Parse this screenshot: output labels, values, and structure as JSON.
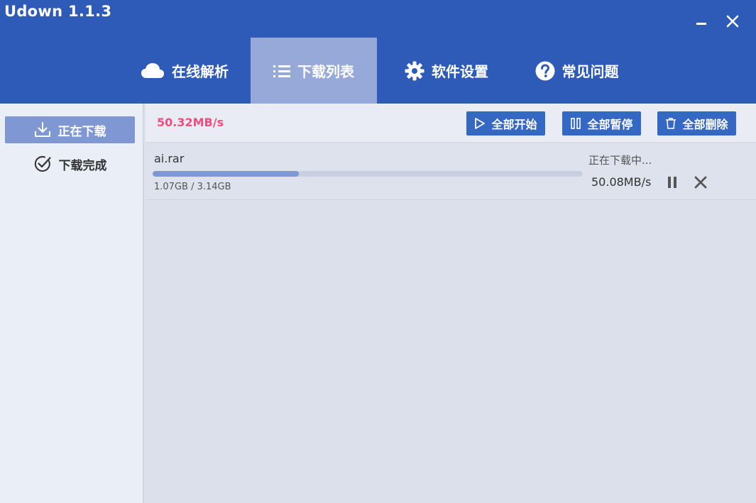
{
  "app": {
    "title": "Udown 1.1.3"
  },
  "window": {
    "minimize_icon": "minimize-icon",
    "close_icon": "close-icon"
  },
  "tabs": [
    {
      "label": "在线解析",
      "icon": "cloud-icon"
    },
    {
      "label": "下载列表",
      "icon": "list-icon",
      "active": true
    },
    {
      "label": "软件设置",
      "icon": "gear-icon"
    },
    {
      "label": "常见问题",
      "icon": "question-icon"
    }
  ],
  "sidebar": {
    "items": [
      {
        "label": "正在下载",
        "icon": "download-icon",
        "active": true
      },
      {
        "label": "下载完成",
        "icon": "check-circle-icon"
      }
    ]
  },
  "toolbar": {
    "total_speed": "50.32MB/s",
    "start_all_label": "全部开始",
    "pause_all_label": "全部暂停",
    "delete_all_label": "全部删除"
  },
  "tasks": [
    {
      "name": "ai.rar",
      "size_text": "1.07GB / 3.14GB",
      "progress": 0.34,
      "status": "正在下载中...",
      "speed": "50.08MB/s"
    }
  ],
  "colors": {
    "header": "#2f5bb8",
    "active_tab": "#97a9d8",
    "button": "#3567c4",
    "speed_accent": "#f04c7d",
    "progress": "#7f98d4"
  }
}
